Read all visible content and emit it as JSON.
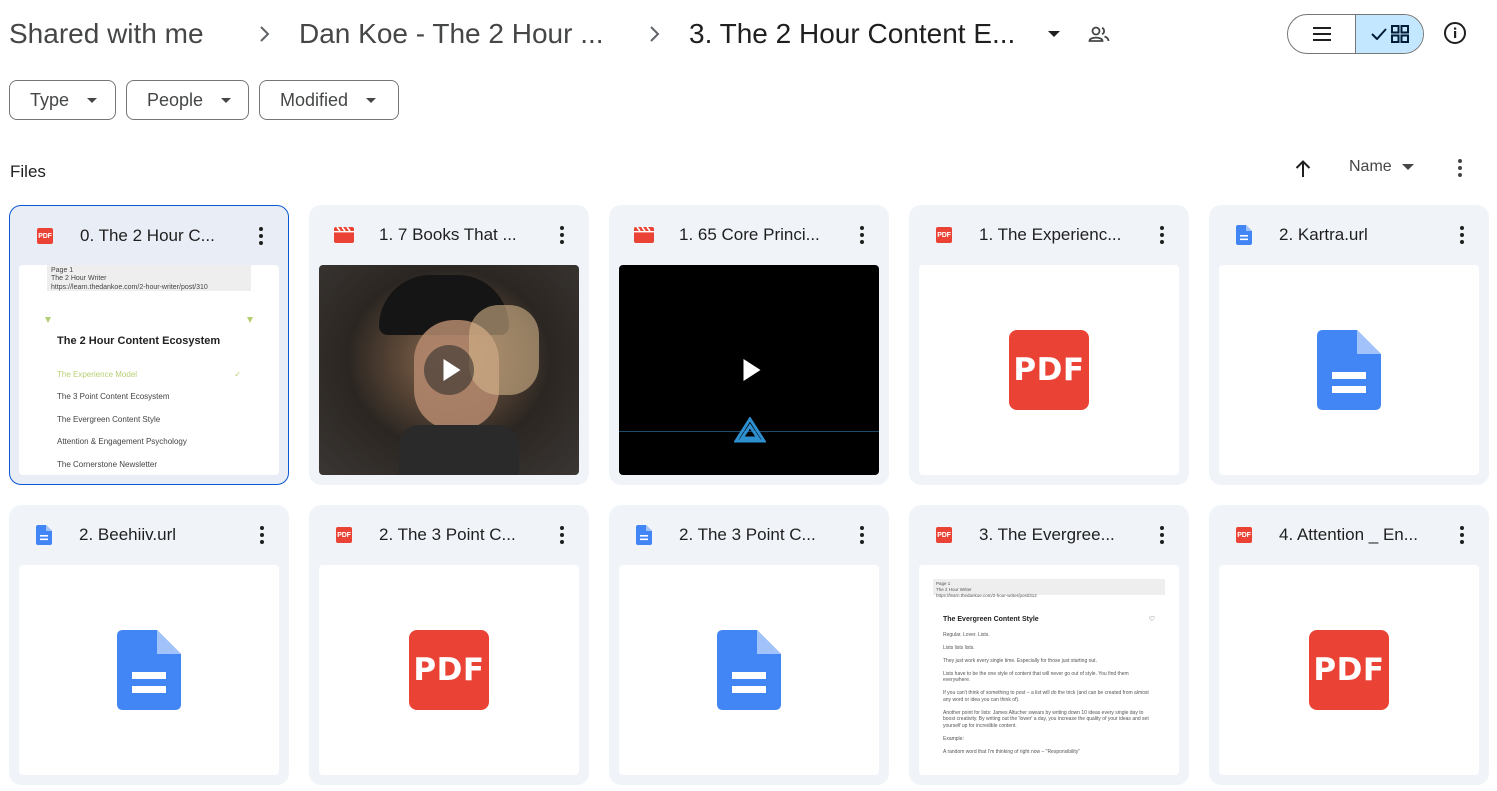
{
  "breadcrumb": {
    "items": [
      {
        "label": "Shared with me"
      },
      {
        "label": "Dan Koe - The 2 Hour ..."
      },
      {
        "label": "3. The 2 Hour Content E..."
      }
    ]
  },
  "icons": {
    "separator": "chevron-right-icon",
    "dropdown": "arrow-drop-down-icon",
    "shared": "people-icon",
    "list_view": "list-view-icon",
    "grid_view": "grid-view-icon",
    "info": "info-icon"
  },
  "filters": [
    {
      "label": "Type"
    },
    {
      "label": "People"
    },
    {
      "label": "Modified"
    }
  ],
  "files_header": {
    "label": "Files",
    "sort_label": "Name",
    "sort_direction": "ascending"
  },
  "colors": {
    "accent": "#0b57d0",
    "selected_toggle": "#c2e7ff",
    "card_bg": "#f0f4f9",
    "pdf_red": "#ea4335",
    "doc_blue": "#4285f4",
    "video_red": "#ea4335"
  },
  "doc_preview_1": {
    "header_line1": "Page 1",
    "header_line2": "The 2 Hour Writer",
    "header_line3": "https://learn.thedankoe.com/2-hour-writer/post/310",
    "heading": "The 2 Hour Content Ecosystem",
    "toc": [
      "The Experience Model",
      "The 3 Point Content Ecosystem",
      "The Evergreen Content Style",
      "Attention & Engagement Psychology",
      "The Cornerstone Newsletter"
    ]
  },
  "doc_preview_2": {
    "header_line1": "Page 1",
    "header_line2": "The 2 Hour Writer",
    "header_line3": "https://learn.thedankoe.com/2-hour-writer/post/312",
    "heading": "The Evergreen Content Style",
    "paragraphs": [
      "Regular. Lover. Lists.",
      "Lists lists lists.",
      "They just work every single time. Especially for those just starting out.",
      "Lists have to be the one style of content that will never go out of style. You find them everywhere.",
      "If you can't think of something to post – a list will do the trick (and can be created from almost any word or idea you can think of).",
      "Another point for lists: James Altucher swears by writing down 10 ideas every single day to boost creativity. By writing out the 'lower' a day, you increase the quality of your ideas and set yourself up for incredible content.",
      "Example:",
      "A random word that I'm thinking of right now – \"Responsibility\""
    ]
  },
  "files": [
    {
      "name": "0. The 2 Hour C...",
      "type": "pdf",
      "preview": "doc1",
      "selected": true
    },
    {
      "name": "1. 7 Books That ...",
      "type": "video",
      "preview": "video-person"
    },
    {
      "name": "1. 65 Core Princi...",
      "type": "video",
      "preview": "video-dark"
    },
    {
      "name": "1. The Experienc...",
      "type": "pdf",
      "preview": "pdf"
    },
    {
      "name": "2. Kartra.url",
      "type": "doc",
      "preview": "doc"
    },
    {
      "name": "2. Beehiiv.url",
      "type": "doc",
      "preview": "doc"
    },
    {
      "name": "2. The 3 Point C...",
      "type": "pdf",
      "preview": "pdf"
    },
    {
      "name": "2. The 3 Point C...",
      "type": "doc",
      "preview": "doc"
    },
    {
      "name": "3. The Evergree...",
      "type": "pdf",
      "preview": "doc2"
    },
    {
      "name": "4. Attention _ En...",
      "type": "pdf",
      "preview": "pdf"
    }
  ],
  "file_type_badge": "PDF"
}
